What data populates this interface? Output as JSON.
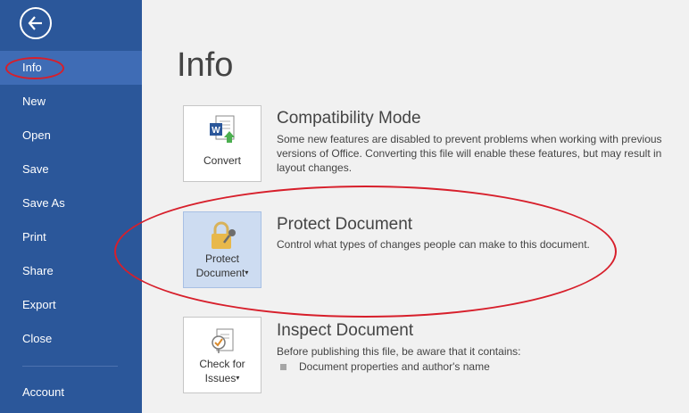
{
  "colors": {
    "sidebar_bg": "#2b579a",
    "sidebar_active": "#3f6cb5",
    "annotation_red": "#d71f2b",
    "selected_tile": "#cddcf1"
  },
  "sidebar": {
    "back_icon": "arrow-left-circle",
    "items": [
      {
        "label": "Info"
      },
      {
        "label": "New"
      },
      {
        "label": "Open"
      },
      {
        "label": "Save"
      },
      {
        "label": "Save As"
      },
      {
        "label": "Print"
      },
      {
        "label": "Share"
      },
      {
        "label": "Export"
      },
      {
        "label": "Close"
      },
      {
        "label": "Account"
      }
    ],
    "active": "Info"
  },
  "main": {
    "title": "Info",
    "sections": [
      {
        "button_label": "Convert",
        "icon": "word-convert-icon",
        "title": "Compatibility Mode",
        "description": "Some new features are disabled to prevent problems when working with previous versions of Office. Converting this file will enable these features, but may result in layout changes."
      },
      {
        "button_label_line1": "Protect",
        "button_label_line2": "Document",
        "caret": "▾",
        "icon": "lock-key-icon",
        "title": "Protect Document",
        "description": "Control what types of changes people can make to this document."
      },
      {
        "button_label_line1": "Check for",
        "button_label_line2": "Issues",
        "caret": "▾",
        "icon": "inspect-document-icon",
        "title": "Inspect Document",
        "description": "Before publishing this file, be aware that it contains:",
        "bullets": [
          "Document properties and author's name"
        ]
      }
    ]
  }
}
